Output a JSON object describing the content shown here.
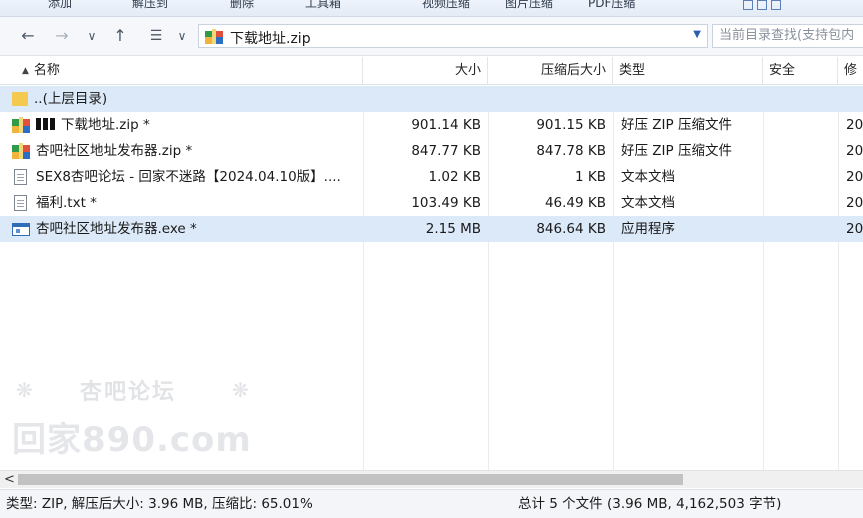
{
  "toolbar": {
    "items": [
      "添加",
      "解压到",
      "删除",
      "工具箱",
      "视频压缩",
      "图片压缩",
      "PDF压缩"
    ]
  },
  "address": {
    "path": "下载地址.zip",
    "search_placeholder": "当前目录查找(支持包内"
  },
  "columns": {
    "name": "名称",
    "size": "大小",
    "packed": "压缩后大小",
    "type": "类型",
    "security": "安全",
    "modified": "修"
  },
  "files": [
    {
      "name": "..(上层目录)",
      "size": "",
      "packed": "",
      "type": "",
      "modified": "",
      "icon": "folder-icon"
    },
    {
      "name": "下载地址.zip *",
      "size": "901.14 KB",
      "packed": "901.15 KB",
      "type": "好压 ZIP 压缩文件",
      "modified": "20",
      "icon": "zip-archive-icon",
      "redacted_prefix": true
    },
    {
      "name": "杏吧社区地址发布器.zip *",
      "size": "847.77 KB",
      "packed": "847.78 KB",
      "type": "好压 ZIP 压缩文件",
      "modified": "20",
      "icon": "zip-archive-icon"
    },
    {
      "name": "SEX8杏吧论坛 - 回家不迷路【2024.04.10版】....",
      "size": "1.02 KB",
      "packed": "1 KB",
      "type": "文本文档",
      "modified": "20",
      "icon": "text-file-icon"
    },
    {
      "name": "福利.txt *",
      "size": "103.49 KB",
      "packed": "46.49 KB",
      "type": "文本文档",
      "modified": "20",
      "icon": "text-file-icon"
    },
    {
      "name": "杏吧社区地址发布器.exe *",
      "size": "2.15 MB",
      "packed": "846.64 KB",
      "type": "应用程序",
      "modified": "20",
      "icon": "executable-icon"
    }
  ],
  "watermark": {
    "line1": "杏吧论坛",
    "line2": "回家890.com"
  },
  "status": {
    "left": "类型: ZIP, 解压后大小: 3.96 MB, 压缩比: 65.01%",
    "right": "总计 5 个文件 (3.96 MB, 4,162,503 字节)"
  },
  "colors": {
    "selected_row": "#dce9f8",
    "folder": "#f3c94f",
    "accent": "#2f6db6"
  }
}
